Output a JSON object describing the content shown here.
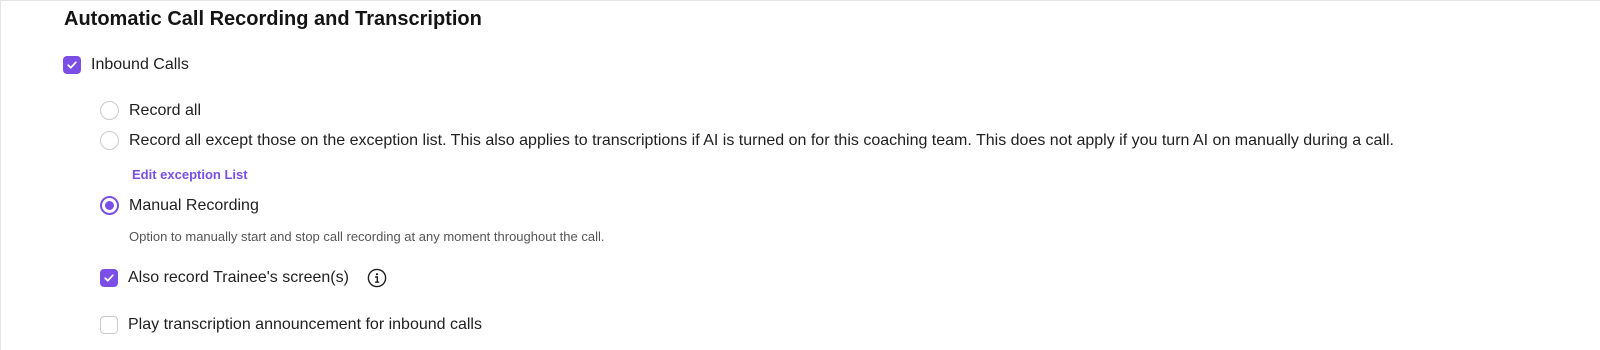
{
  "section": {
    "title": "Automatic Call Recording and Transcription"
  },
  "inbound": {
    "label": "Inbound Calls",
    "checked": true
  },
  "options": {
    "record_all": "Record all",
    "record_except": "Record all except those on the exception list. This also applies to transcriptions if AI is turned on for this coaching team. This does not apply if you turn AI on manually during a call.",
    "edit_exception": "Edit exception List",
    "manual": "Manual Recording",
    "manual_help": "Option to manually start and stop call recording at any moment throughout the call.",
    "selected": "manual"
  },
  "screen": {
    "label": "Also record Trainee's screen(s)",
    "checked": true,
    "icon": "info-icon"
  },
  "announcement": {
    "label": "Play transcription announcement for inbound calls",
    "checked": false
  },
  "colors": {
    "accent": "#7b4fe6"
  }
}
